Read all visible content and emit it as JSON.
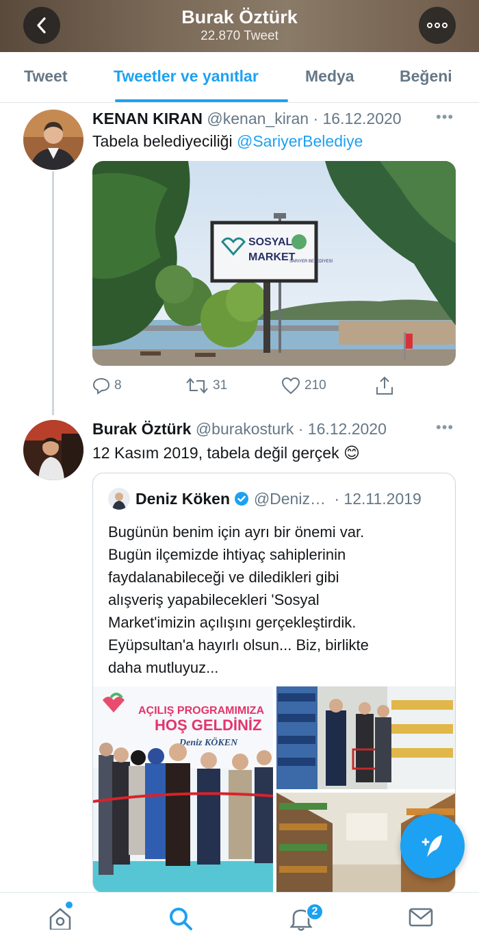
{
  "header": {
    "title": "Burak Öztürk",
    "subtitle": "22.870 Tweet"
  },
  "tabs": [
    {
      "label": "Tweet"
    },
    {
      "label": "Tweetler ve yanıtlar",
      "active": true
    },
    {
      "label": "Medya"
    },
    {
      "label": "Beğeni"
    }
  ],
  "tweet1": {
    "name": "KENAN KIRAN",
    "handle": "@kenan_kiran · 16.12.2020",
    "text": "Tabela belediyeciliği ",
    "mention": "@SariyerBelediye",
    "photo": {
      "sign_line1": "SOSYAL",
      "sign_line2": "MARKET",
      "sign_brand": "SARIYER BELEDİYESİ"
    },
    "actions": {
      "replies": "8",
      "retweets": "31",
      "likes": "210"
    }
  },
  "tweet2": {
    "name": "Burak Öztürk",
    "handle": "@burakosturk · 16.12.2020",
    "text": "12 Kasım 2019, tabela değil gerçek 😊",
    "quote": {
      "name": "Deniz Köken",
      "handle": "@Deniz…",
      "date": "· 12.11.2019",
      "lines": [
        "Bugünün benim için ayrı bir önemi var.",
        "Bugün ilçemizde ihtiyaç sahiplerinin",
        "faydalanabileceği ve diledikleri gibi",
        "alışveriş yapabilecekleri 'Sosyal",
        "Market'imizin açılışını gerçekleştirdik.",
        "Eyüpsultan'a hayırlı olsun... Biz, birlikte",
        "daha mutluyuz..."
      ],
      "banner": {
        "line1": "AÇILIŞ PROGRAMIMIZA",
        "line2": "HOŞ GELDİNİZ",
        "line3": "Deniz KÖKEN"
      }
    }
  },
  "bottom_nav": {
    "notification_badge": "2"
  },
  "colors": {
    "accent": "#1da1f2",
    "muted": "#657786",
    "border": "#ccd6dd"
  }
}
